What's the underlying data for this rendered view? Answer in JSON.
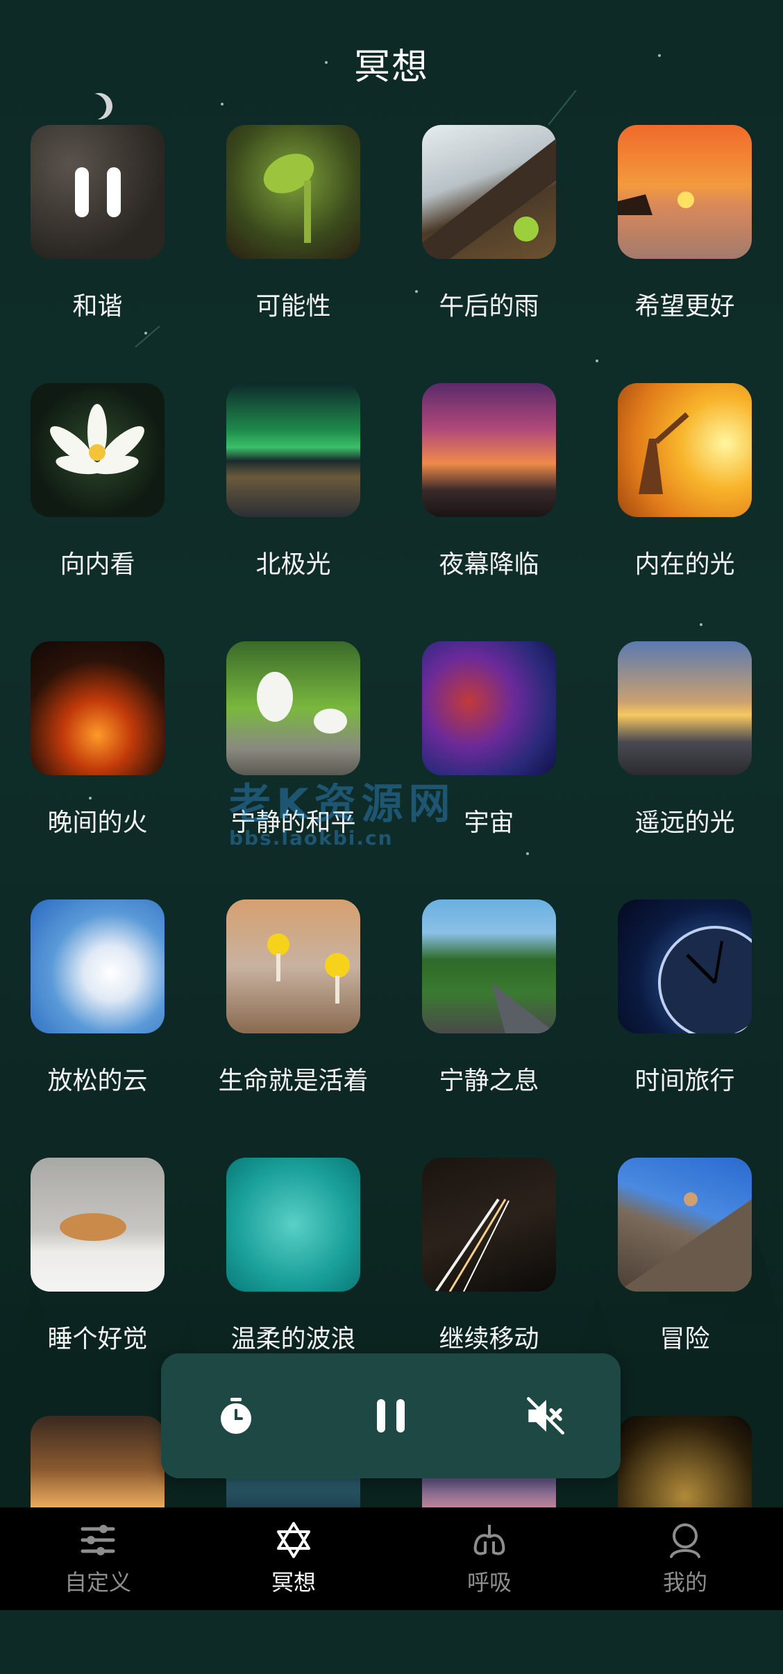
{
  "header": {
    "title": "冥想"
  },
  "grid": [
    {
      "label": "和谐",
      "playing": true
    },
    {
      "label": "可能性"
    },
    {
      "label": "午后的雨"
    },
    {
      "label": "希望更好"
    },
    {
      "label": "向内看"
    },
    {
      "label": "北极光"
    },
    {
      "label": "夜幕降临"
    },
    {
      "label": "内在的光"
    },
    {
      "label": "晚间的火"
    },
    {
      "label": "宁静的和平"
    },
    {
      "label": "宇宙"
    },
    {
      "label": "遥远的光"
    },
    {
      "label": "放松的云"
    },
    {
      "label": "生命就是活着"
    },
    {
      "label": "宁静之息"
    },
    {
      "label": "时间旅行"
    },
    {
      "label": "睡个好觉"
    },
    {
      "label": "温柔的波浪"
    },
    {
      "label": "继续移动"
    },
    {
      "label": "冒险"
    },
    {
      "label": ""
    },
    {
      "label": ""
    },
    {
      "label": ""
    },
    {
      "label": ""
    }
  ],
  "watermark": {
    "text": "老K资源网",
    "sub": "bbs.laokbi.cn"
  },
  "player": {
    "timer_icon": "timer-icon",
    "pause_icon": "pause-icon",
    "mute_icon": "mute-icon"
  },
  "tabs": [
    {
      "label": "自定义",
      "icon": "sliders-icon",
      "active": false
    },
    {
      "label": "冥想",
      "icon": "star-of-david-icon",
      "active": true
    },
    {
      "label": "呼吸",
      "icon": "lungs-icon",
      "active": false
    },
    {
      "label": "我的",
      "icon": "user-icon",
      "active": false
    }
  ],
  "colors": {
    "background": "#0d2a26",
    "player": "#1e4844",
    "tabbar": "#000000",
    "tab_active": "#ffffff",
    "tab_inactive": "#8e8e8e"
  }
}
